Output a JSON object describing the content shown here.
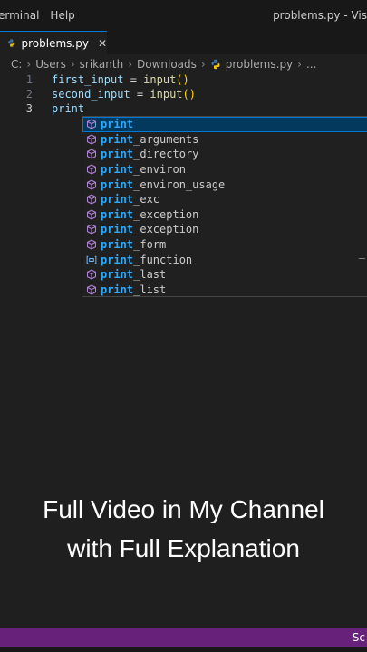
{
  "menubar": {
    "items": [
      "erminal",
      "Help"
    ],
    "window_title": "problems.py - Vis"
  },
  "tab": {
    "label": "problems.py",
    "close_glyph": "✕"
  },
  "breadcrumb": {
    "segments": [
      "C:",
      "Users",
      "srikanth",
      "Downloads",
      "problems.py",
      "..."
    ],
    "separator": "›"
  },
  "editor": {
    "lines": [
      {
        "number": "1",
        "var": "first_input",
        "op": " = ",
        "fn": "input",
        "parens": "()"
      },
      {
        "number": "2",
        "var": "second_input",
        "op": " = ",
        "fn": "input",
        "parens": "()"
      },
      {
        "number": "3",
        "text": "print"
      }
    ]
  },
  "suggestions": {
    "typed": "print",
    "items": [
      {
        "match": "print",
        "rest": "",
        "kind": "class-icon",
        "selected": true
      },
      {
        "match": "print",
        "rest": "_arguments",
        "kind": "class-icon"
      },
      {
        "match": "print",
        "rest": "_directory",
        "kind": "class-icon"
      },
      {
        "match": "print",
        "rest": "_environ",
        "kind": "class-icon"
      },
      {
        "match": "print",
        "rest": "_environ_usage",
        "kind": "class-icon"
      },
      {
        "match": "print",
        "rest": "_exc",
        "kind": "class-icon"
      },
      {
        "match": "print",
        "rest": "_exception",
        "kind": "class-icon"
      },
      {
        "match": "print",
        "rest": "_exception",
        "kind": "class-icon"
      },
      {
        "match": "print",
        "rest": "_form",
        "kind": "class-icon"
      },
      {
        "match": "print",
        "rest": "_function",
        "kind": "variable-icon",
        "trailing": "–"
      },
      {
        "match": "print",
        "rest": "_last",
        "kind": "class-icon"
      },
      {
        "match": "print",
        "rest": "_list",
        "kind": "class-icon"
      }
    ]
  },
  "caption": {
    "line1": "Full Video in My Channel",
    "line2": "with Full Explanation"
  },
  "statusbar": {
    "text": "Sc",
    "color": "#68217a"
  },
  "colors": {
    "accent": "#0078d4",
    "match": "#2aaaff",
    "icon": "#b180d7"
  }
}
